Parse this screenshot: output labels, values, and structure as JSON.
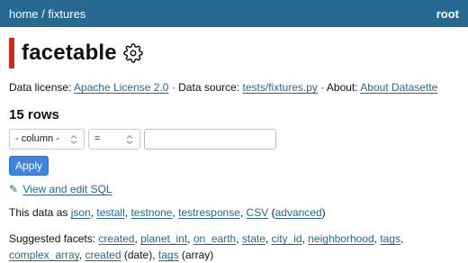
{
  "nav": {
    "home": "home",
    "sep": "/",
    "db": "fixtures",
    "user": "root"
  },
  "page": {
    "title": "facetable"
  },
  "meta": {
    "license_label": "Data license:",
    "license_link": "Apache License 2.0",
    "source_label": "· Data source:",
    "source_link": "tests/fixtures.py",
    "about_label": "· About:",
    "about_link": "About Datasette"
  },
  "row_count": "15 rows",
  "filter": {
    "column_value": "- column -",
    "op_value": "=",
    "value_placeholder": "",
    "apply_label": "Apply"
  },
  "sql_link": "View and edit SQL",
  "export": {
    "prefix": "This data as",
    "formats": [
      "json",
      "testall",
      "testnone",
      "testresponse",
      "CSV"
    ],
    "advanced": "advanced"
  },
  "facets": {
    "label": "Suggested facets:",
    "items": [
      "created",
      "planet_int",
      "on_earth",
      "state",
      "city_id",
      "neighborhood",
      "tags",
      "complex_array"
    ],
    "extra": [
      {
        "name": "created",
        "kind": "(date)"
      },
      {
        "name": "tags",
        "kind": "(array)"
      }
    ]
  },
  "colors": {
    "header": "#276890",
    "accent_bar": "#d12a1a",
    "button": "#3d84dd"
  },
  "icons": {
    "settings": "gear-icon",
    "edit": "pencil-icon",
    "dropdown": "chevron-updown-icon"
  }
}
